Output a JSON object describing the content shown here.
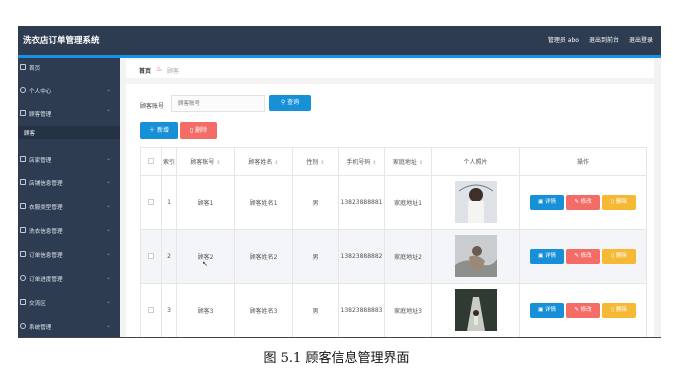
{
  "header": {
    "app_title": "洗衣店订单管理系统",
    "admin_label": "管理员 abo",
    "to_frontend": "退出到前台",
    "logout": "退出登录"
  },
  "sidebar": {
    "items": [
      {
        "label": "首页",
        "icon": "home-icon",
        "chevron": false
      },
      {
        "label": "个人中心",
        "icon": "user-icon",
        "chevron": true
      },
      {
        "label": "顾客管理",
        "icon": "customer-icon",
        "chevron": true
      },
      {
        "label": "顾客",
        "icon": "",
        "chevron": false,
        "sub": true
      },
      {
        "label": "店家管理",
        "icon": "shop-icon",
        "chevron": true
      },
      {
        "label": "店铺信息管理",
        "icon": "list-icon",
        "chevron": true
      },
      {
        "label": "衣服类型管理",
        "icon": "tag-icon",
        "chevron": true
      },
      {
        "label": "洗衣信息管理",
        "icon": "wash-icon",
        "chevron": true
      },
      {
        "label": "订单信息管理",
        "icon": "order-icon",
        "chevron": true
      },
      {
        "label": "订单进度管理",
        "icon": "progress-icon",
        "chevron": true
      },
      {
        "label": "交流区",
        "icon": "chat-icon",
        "chevron": true
      },
      {
        "label": "系统管理",
        "icon": "settings-icon",
        "chevron": true
      }
    ]
  },
  "breadcrumb": {
    "home": "首页",
    "current": "顾客"
  },
  "search": {
    "label": "顾客账号",
    "placeholder": "顾客账号",
    "button": "查询"
  },
  "toolbar": {
    "add": "新增",
    "delete": "删除"
  },
  "table": {
    "headers": [
      "索引",
      "顾客账号",
      "顾客姓名",
      "性别",
      "手机号码",
      "家庭地址",
      "个人照片",
      "操作"
    ],
    "rows": [
      {
        "index": "1",
        "account": "顾客1",
        "name": "顾客姓名1",
        "gender": "男",
        "phone": "13823888881",
        "address": "家庭地址1"
      },
      {
        "index": "2",
        "account": "顾客2",
        "name": "顾客姓名2",
        "gender": "男",
        "phone": "13823888882",
        "address": "家庭地址2"
      },
      {
        "index": "3",
        "account": "顾客3",
        "name": "顾客姓名3",
        "gender": "男",
        "phone": "13823888883",
        "address": "家庭地址3"
      }
    ],
    "actions": {
      "detail": "详情",
      "edit": "修改",
      "delete": "删除"
    }
  },
  "caption": "图 5.1  顾客信息管理界面",
  "colors": {
    "topbar": "#2e3c51",
    "accent": "#1890d8",
    "danger": "#f36c66",
    "warning": "#f5b936"
  }
}
